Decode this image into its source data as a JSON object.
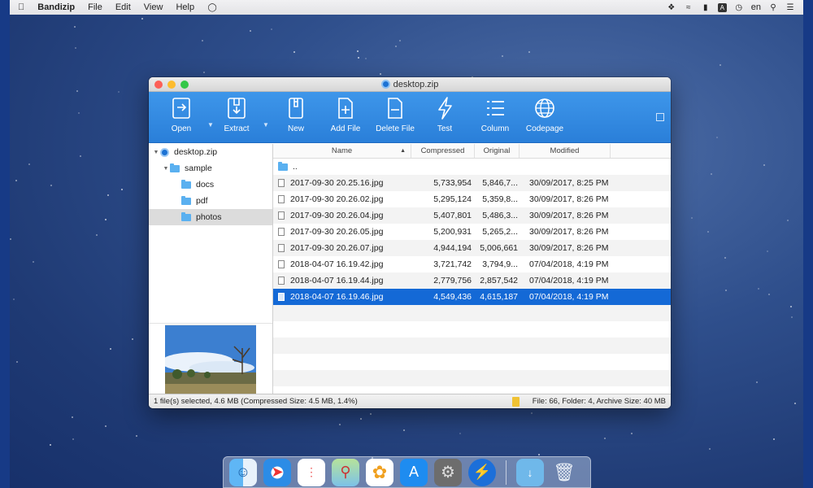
{
  "menubar": {
    "apple_icon": "apple-icon",
    "app_name": "Bandizip",
    "items": [
      "File",
      "Edit",
      "View",
      "Help"
    ],
    "status": {
      "language": "en"
    }
  },
  "window": {
    "title": "desktop.zip"
  },
  "toolbar": {
    "open": "Open",
    "extract": "Extract",
    "new": "New",
    "add_file": "Add File",
    "delete_file": "Delete File",
    "test": "Test",
    "column": "Column",
    "codepage": "Codepage"
  },
  "tree": {
    "root": "desktop.zip",
    "sample": "sample",
    "docs": "docs",
    "pdf": "pdf",
    "photos": "photos"
  },
  "list": {
    "headers": {
      "name": "Name",
      "compressed": "Compressed",
      "original": "Original",
      "modified": "Modified"
    },
    "parent": "..",
    "rows": [
      {
        "name": "2017-09-30 20.25.16.jpg",
        "compressed": "5,733,954",
        "original": "5,846,7...",
        "modified": "30/09/2017, 8:25 PM"
      },
      {
        "name": "2017-09-30 20.26.02.jpg",
        "compressed": "5,295,124",
        "original": "5,359,8...",
        "modified": "30/09/2017, 8:26 PM"
      },
      {
        "name": "2017-09-30 20.26.04.jpg",
        "compressed": "5,407,801",
        "original": "5,486,3...",
        "modified": "30/09/2017, 8:26 PM"
      },
      {
        "name": "2017-09-30 20.26.05.jpg",
        "compressed": "5,200,931",
        "original": "5,265,2...",
        "modified": "30/09/2017, 8:26 PM"
      },
      {
        "name": "2017-09-30 20.26.07.jpg",
        "compressed": "4,944,194",
        "original": "5,006,661",
        "modified": "30/09/2017, 8:26 PM"
      },
      {
        "name": "2018-04-07 16.19.42.jpg",
        "compressed": "3,721,742",
        "original": "3,794,9...",
        "modified": "07/04/2018, 4:19 PM"
      },
      {
        "name": "2018-04-07 16.19.44.jpg",
        "compressed": "2,779,756",
        "original": "2,857,542",
        "modified": "07/04/2018, 4:19 PM"
      },
      {
        "name": "2018-04-07 16.19.46.jpg",
        "compressed": "4,549,436",
        "original": "4,615,187",
        "modified": "07/04/2018, 4:19 PM"
      }
    ]
  },
  "status": {
    "selection": "1 file(s) selected, 4.6 MB (Compressed Size: 4.5 MB, 1.4%)",
    "summary": "File: 66, Folder: 4, Archive Size: 40 MB"
  }
}
